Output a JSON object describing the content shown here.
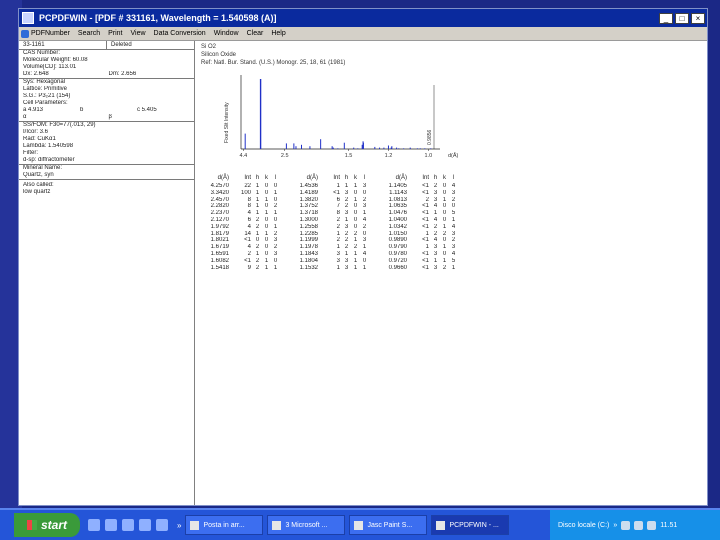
{
  "window": {
    "title": "PCPDFWIN - [PDF # 331161, Wavelength = 1.540598 (A)]",
    "controls": [
      "_",
      "□",
      "×"
    ]
  },
  "menu": [
    "PDFNumber",
    "Search",
    "Print",
    "View",
    "Data Conversion",
    "Window",
    "Clear",
    "Help"
  ],
  "left": {
    "pdf_no": "33-1161",
    "deleted": "Deleted",
    "info": [
      "CAS Number:",
      "Molecular Weight: 60.08",
      "Volume[CD]: 113.01",
      "Dx: 2.648",
      "Dm: 2.656"
    ],
    "crystal": [
      "Sys: Hexagonal",
      "Lattice: Primitive",
      "S.G.: P3₂21 (154)",
      "Cell Parameters:"
    ],
    "cell_a": "a 4.913",
    "cell_b": "b",
    "cell_c": "c 5.405",
    "cell_alpha": "α",
    "cell_beta": "β",
    "refs": [
      "SS/FOM: F30=77(.013, 29)",
      "I/Icor: 3.6",
      "Rad: CuKα1",
      "Lambda: 1.540598",
      "Filter:",
      "d-sp: diffractometer"
    ],
    "names": [
      "Mineral Name:",
      "Quartz, syn"
    ],
    "other": [
      "Also called:",
      "low quartz"
    ]
  },
  "header": {
    "formula": "Si O2",
    "name": "Silicon Oxide",
    "ref": "Ref: Natl. Bur. Stand. (U.S.) Monogr. 25, 18, 61 (1981)"
  },
  "chart_data": {
    "type": "bar",
    "ylabel": "Fixed Slit Intensity",
    "xlabel": "d(Å)",
    "x_ticks": [
      "4.4",
      "2.5",
      "1.5",
      "1.2",
      "1.0"
    ],
    "cutoff_label": "0.9856",
    "d_values": [
      4.257,
      3.342,
      2.457,
      2.282,
      2.237,
      2.127,
      1.979,
      1.818,
      1.672,
      1.659,
      1.608,
      1.541,
      1.453,
      1.418,
      1.382,
      1.375,
      1.372,
      1.288,
      1.256,
      1.228,
      1.2,
      1.184,
      1.18,
      1.153,
      1.141,
      1.115,
      1.082,
      1.048,
      1.035,
      1.015,
      0.99
    ],
    "intensities": [
      22,
      100,
      8,
      8,
      4,
      6,
      4,
      14,
      4,
      2,
      1,
      9,
      2,
      1,
      6,
      11,
      9,
      3,
      2,
      2,
      5,
      2,
      4,
      2,
      1,
      1,
      2,
      1,
      1,
      1,
      1
    ]
  },
  "table": {
    "headers": [
      "d(Å)",
      "Int",
      "h",
      "k",
      "l",
      "d(Å)",
      "Int",
      "h",
      "k",
      "l",
      "d(Å)",
      "Int",
      "h",
      "k",
      "l"
    ],
    "rows": [
      [
        "4.2570",
        "22",
        "1",
        "0",
        "0",
        "1.4536",
        "1",
        "1",
        "1",
        "3",
        "1.1405",
        "<1",
        "2",
        "0",
        "4"
      ],
      [
        "3.3420",
        "100",
        "1",
        "0",
        "1",
        "1.4189",
        "<1",
        "3",
        "0",
        "0",
        "1.1143",
        "<1",
        "3",
        "0",
        "3"
      ],
      [
        "2.4570",
        "8",
        "1",
        "1",
        "0",
        "1.3820",
        "6",
        "2",
        "1",
        "2",
        "1.0813",
        "2",
        "3",
        "1",
        "2"
      ],
      [
        "2.2820",
        "8",
        "1",
        "0",
        "2",
        "1.3752",
        "7",
        "2",
        "0",
        "3",
        "1.0635",
        "<1",
        "4",
        "0",
        "0"
      ],
      [
        "2.2370",
        "4",
        "1",
        "1",
        "1",
        "1.3718",
        "8",
        "3",
        "0",
        "1",
        "1.0476",
        "<1",
        "1",
        "0",
        "5"
      ],
      [
        "2.1270",
        "6",
        "2",
        "0",
        "0",
        "1.3000",
        "2",
        "1",
        "0",
        "4",
        "1.0400",
        "<1",
        "4",
        "0",
        "1"
      ],
      [
        "1.9792",
        "4",
        "2",
        "0",
        "1",
        "1.2558",
        "2",
        "3",
        "0",
        "2",
        "1.0342",
        "<1",
        "2",
        "1",
        "4"
      ],
      [
        "1.8179",
        "14",
        "1",
        "1",
        "2",
        "1.2285",
        "1",
        "2",
        "2",
        "0",
        "1.0150",
        "1",
        "2",
        "2",
        "3"
      ],
      [
        "1.8021",
        "<1",
        "0",
        "0",
        "3",
        "1.1999",
        "2",
        "2",
        "1",
        "3",
        "0.9890",
        "<1",
        "4",
        "0",
        "2"
      ],
      [
        "1.6719",
        "4",
        "2",
        "0",
        "2",
        "1.1978",
        "1",
        "2",
        "2",
        "1",
        "0.9790",
        "1",
        "3",
        "1",
        "3"
      ],
      [
        "1.6591",
        "2",
        "1",
        "0",
        "3",
        "1.1843",
        "3",
        "1",
        "1",
        "4",
        "0.9780",
        "<1",
        "3",
        "0",
        "4"
      ],
      [
        "1.6082",
        "<1",
        "2",
        "1",
        "0",
        "1.1804",
        "3",
        "3",
        "1",
        "0",
        "0.9720",
        "<1",
        "1",
        "1",
        "5"
      ],
      [
        "1.5418",
        "9",
        "2",
        "1",
        "1",
        "1.1532",
        "1",
        "3",
        "1",
        "1",
        "0.9660",
        "<1",
        "3",
        "2",
        "1"
      ]
    ]
  },
  "taskbar": {
    "start": "start",
    "tasks": [
      "Posta in arr...",
      "3 Microsoft ...",
      "Jasc Paint S...",
      "PCPDFWIN - ..."
    ],
    "tray_text": "Disco locale (C:)",
    "clock": "11.51"
  }
}
